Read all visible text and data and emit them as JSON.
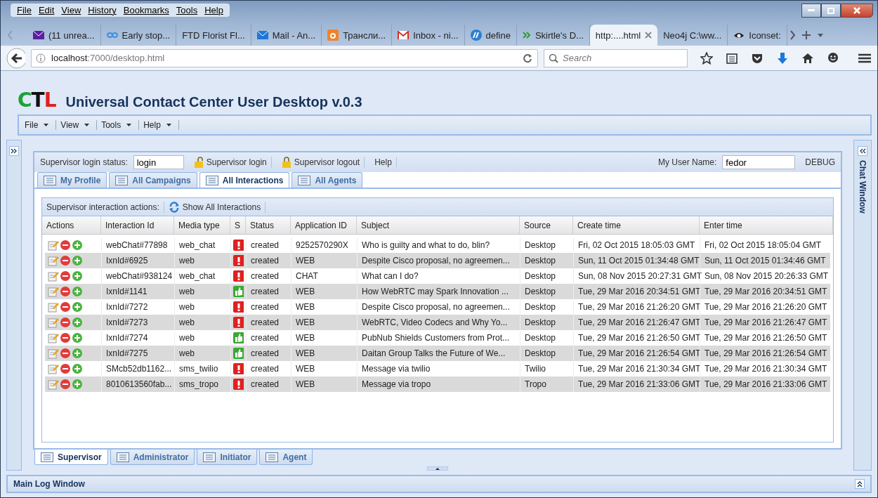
{
  "browser": {
    "menu": [
      "File",
      "Edit",
      "View",
      "History",
      "Bookmarks",
      "Tools",
      "Help"
    ],
    "tabs": [
      {
        "label": "(11 unrea...",
        "selected": false
      },
      {
        "label": "Early stop...",
        "selected": false
      },
      {
        "label": "FTD Florist Fl...",
        "selected": false
      },
      {
        "label": "Mail - An...",
        "selected": false
      },
      {
        "label": "Трансли...",
        "selected": false
      },
      {
        "label": "Inbox - ni...",
        "selected": false
      },
      {
        "label": "define",
        "selected": false
      },
      {
        "label": "Skirtle's D...",
        "selected": false
      },
      {
        "label": "http:....html",
        "selected": true
      },
      {
        "label": "Neo4j C:\\ww...",
        "selected": false
      },
      {
        "label": "Iconset:",
        "selected": false
      }
    ],
    "url_host": "localhost",
    "url_rest": ":7000/desktop.html",
    "search": {
      "placeholder": "Search"
    }
  },
  "app": {
    "logo": [
      "C",
      "T",
      "L"
    ],
    "title": "Universal Contact Center User Desktop v.0.3",
    "menu": [
      "File",
      "View",
      "Tools",
      "Help"
    ],
    "supervisor_bar": {
      "label": "Supervisor login status:",
      "status_value": "login",
      "buttons": [
        "Supervisor login",
        "Supervisor logout"
      ],
      "help": "Help",
      "user_label": "My User Name:",
      "user_value": "fedor",
      "debug": "DEBUG"
    },
    "tabs": [
      {
        "label": "My Profile",
        "selected": false
      },
      {
        "label": "All Campaigns",
        "selected": false
      },
      {
        "label": "All Interactions",
        "selected": true
      },
      {
        "label": "All Agents",
        "selected": false
      }
    ],
    "toolbar": {
      "label": "Supervisor interaction actions:",
      "button": "Show All Interactions"
    },
    "table": {
      "columns": [
        "Actions",
        "Interaction Id",
        "Media type",
        "S",
        "Status",
        "Application ID",
        "Subject",
        "Source",
        "Create time",
        "Enter time"
      ],
      "rows": [
        {
          "id": "webChat#77898",
          "media": "web_chat",
          "kind": "alert",
          "status": "created",
          "app_id": "9252570290X",
          "subject": "Who is guilty and what to do, blin?",
          "source": "Desktop",
          "create": "Fri, 02 Oct 2015 18:05:03 GMT",
          "enter": "Fri, 02 Oct 2015 18:05:04 GMT"
        },
        {
          "id": "IxnId#6925",
          "media": "web",
          "kind": "alert",
          "status": "created",
          "app_id": "WEB",
          "subject": "Despite Cisco proposal, no agreemen...",
          "source": "Desktop",
          "create": "Sun, 11 Oct 2015 01:34:48 GMT",
          "enter": "Sun, 11 Oct 2015 01:34:46 GMT"
        },
        {
          "id": "webChat#938124",
          "media": "web_chat",
          "kind": "alert",
          "status": "created",
          "app_id": "CHAT",
          "subject": "What can I do?",
          "source": "Desktop",
          "create": "Sun, 08 Nov 2015 20:27:31 GMT",
          "enter": "Sun, 08 Nov 2015 20:26:33 GMT"
        },
        {
          "id": "IxnId#1141",
          "media": "web",
          "kind": "ok",
          "status": "created",
          "app_id": "WEB",
          "subject": "How WebRTC may Spark Innovation ...",
          "source": "Desktop",
          "create": "Tue, 29 Mar 2016 20:34:51 GMT",
          "enter": "Tue, 29 Mar 2016 20:34:51 GMT"
        },
        {
          "id": "IxnId#7272",
          "media": "web",
          "kind": "alert",
          "status": "created",
          "app_id": "WEB",
          "subject": "Despite Cisco proposal, no agreemen...",
          "source": "Desktop",
          "create": "Tue, 29 Mar 2016 21:26:20 GMT",
          "enter": "Tue, 29 Mar 2016 21:26:20 GMT"
        },
        {
          "id": "IxnId#7273",
          "media": "web",
          "kind": "alert",
          "status": "created",
          "app_id": "WEB",
          "subject": "WebRTC, Video Codecs and Why Yo...",
          "source": "Desktop",
          "create": "Tue, 29 Mar 2016 21:26:47 GMT",
          "enter": "Tue, 29 Mar 2016 21:26:47 GMT"
        },
        {
          "id": "IxnId#7274",
          "media": "web",
          "kind": "ok",
          "status": "created",
          "app_id": "WEB",
          "subject": "PubNub Shields Customers from Prot...",
          "source": "Desktop",
          "create": "Tue, 29 Mar 2016 21:26:50 GMT",
          "enter": "Tue, 29 Mar 2016 21:26:50 GMT"
        },
        {
          "id": "IxnId#7275",
          "media": "web",
          "kind": "ok",
          "status": "created",
          "app_id": "WEB",
          "subject": "Daitan Group Talks the Future of We...",
          "source": "Desktop",
          "create": "Tue, 29 Mar 2016 21:26:54 GMT",
          "enter": "Tue, 29 Mar 2016 21:26:54 GMT"
        },
        {
          "id": "SMcb52db1162...",
          "media": "sms_twilio",
          "kind": "alert",
          "status": "created",
          "app_id": "WEB",
          "subject": "Message via twilio",
          "source": "Twilio",
          "create": "Tue, 29 Mar 2016 21:30:34 GMT",
          "enter": "Tue, 29 Mar 2016 21:30:34 GMT"
        },
        {
          "id": "8010613560fab...",
          "media": "sms_tropo",
          "kind": "alert",
          "status": "created",
          "app_id": "WEB",
          "subject": "Message via tropo",
          "source": "Tropo",
          "create": "Tue, 29 Mar 2016 21:33:06 GMT",
          "enter": "Tue, 29 Mar 2016 21:33:06 GMT"
        }
      ]
    },
    "bottom_tabs": [
      {
        "label": "Supervisor",
        "selected": true
      },
      {
        "label": "Administrator",
        "selected": false
      },
      {
        "label": "Initiator",
        "selected": false
      },
      {
        "label": "Agent",
        "selected": false
      }
    ],
    "chat_window": "Chat Window",
    "log_window": "Main Log Window"
  }
}
